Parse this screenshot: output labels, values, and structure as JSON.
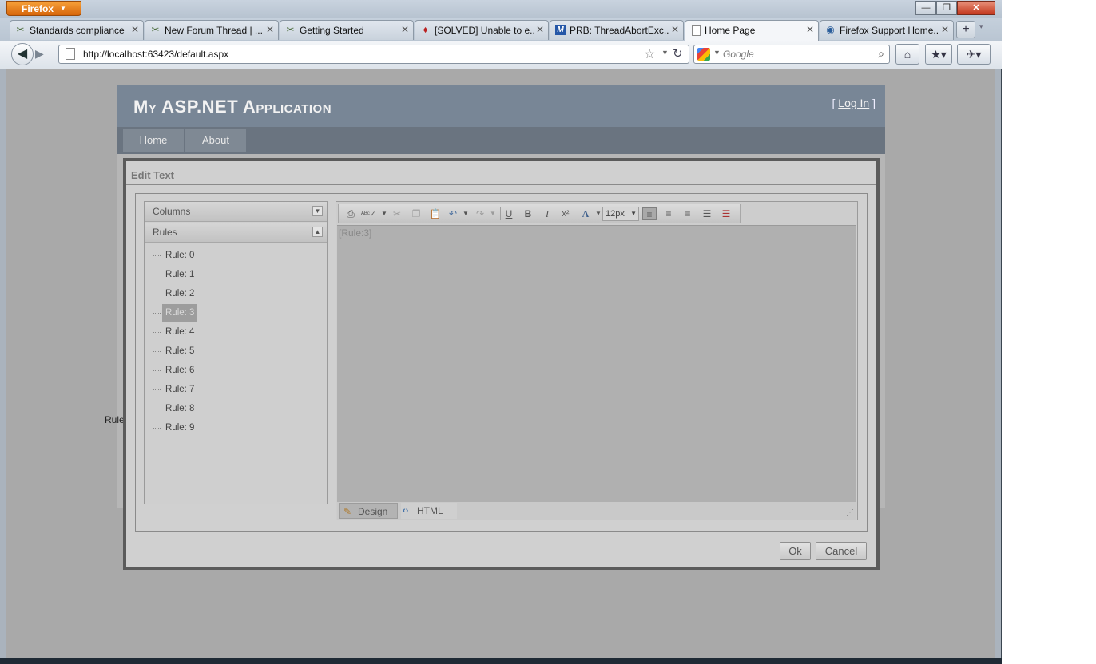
{
  "browser": {
    "menu_button": "Firefox",
    "tabs": [
      {
        "label": "Standards compliance",
        "icon": "forum-icon"
      },
      {
        "label": "New Forum Thread | ...",
        "icon": "forum-icon"
      },
      {
        "label": "Getting Started",
        "icon": "forum-icon"
      },
      {
        "label": "[SOLVED] Unable to e...",
        "icon": "flame-icon"
      },
      {
        "label": "PRB: ThreadAbortExc...",
        "icon": "m-icon"
      },
      {
        "label": "Home Page",
        "icon": "page-icon"
      },
      {
        "label": "Firefox Support Home...",
        "icon": "support-icon"
      }
    ],
    "new_tab": "+",
    "url": "http://localhost:63423/default.aspx",
    "search_placeholder": "Google",
    "window_controls": {
      "minimize": "—",
      "maximize": "❐",
      "close": "✕"
    }
  },
  "app": {
    "title": "My ASP.NET Application",
    "login_open": "[ ",
    "login_label": "Log In",
    "login_close": " ]",
    "menu": [
      "Home",
      "About"
    ],
    "background_fragment": "Rule"
  },
  "dialog": {
    "title": "Edit Text",
    "accordion": {
      "columns_label": "Columns",
      "rules_label": "Rules"
    },
    "rules": [
      "Rule: 0",
      "Rule: 1",
      "Rule: 2",
      "Rule: 3",
      "Rule: 4",
      "Rule: 5",
      "Rule: 6",
      "Rule: 7",
      "Rule: 8",
      "Rule: 9"
    ],
    "selected_rule": "Rule: 3",
    "editor": {
      "content": "[Rule:3]",
      "font_size": "12px",
      "mode_design": "Design",
      "mode_html": "HTML"
    },
    "ok_label": "Ok",
    "cancel_label": "Cancel"
  }
}
